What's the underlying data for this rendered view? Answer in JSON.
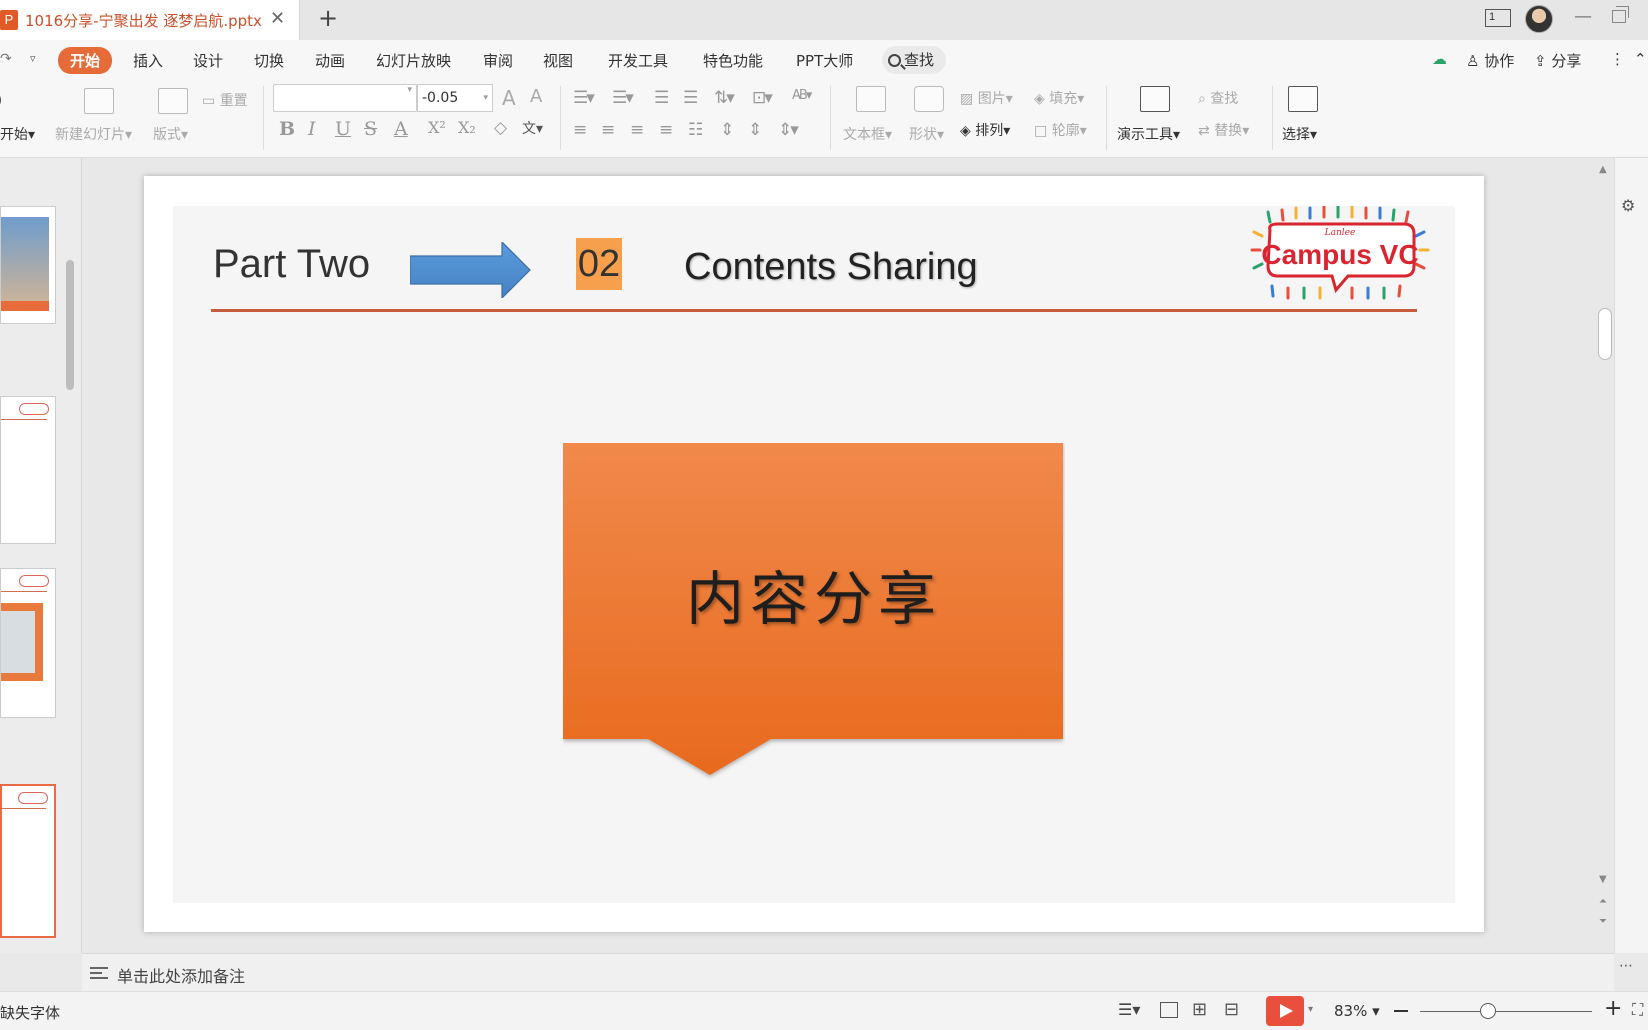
{
  "window": {
    "doc_tab_title": "1016分享-宁聚出发 逐梦启航.pptx",
    "doc_icon_glyph": "P",
    "page_indicator": "1"
  },
  "menu": {
    "items": [
      "开始",
      "插入",
      "设计",
      "切换",
      "动画",
      "幻灯片放映",
      "审阅",
      "视图",
      "开发工具",
      "特色功能",
      "PPT大师"
    ],
    "active": "开始",
    "search_label": "查找",
    "collab_label": "协作",
    "share_label": "分享"
  },
  "ribbon": {
    "start_label": "开始",
    "new_slide_label": "新建幻灯片",
    "layout_label": "版式",
    "reset_label": "重置",
    "font_size_value": "-0.05",
    "text_box_label": "文本框",
    "shape_label": "形状",
    "picture_label": "图片",
    "fill_label": "填充",
    "arrange_label": "排列",
    "outline_label": "轮廓",
    "presentation_tools_label": "演示工具",
    "find_label": "查找",
    "replace_label": "替换",
    "select_label": "选择"
  },
  "slide": {
    "part_label": "Part Two",
    "number": "02",
    "title": "Contents Sharing",
    "callout_text": "内容分享",
    "logo_text": "Campus VC",
    "logo_subtext": "Lanlee"
  },
  "notes": {
    "placeholder": "单击此处添加备注"
  },
  "status": {
    "missing_font": "缺失字体",
    "zoom": "83%"
  },
  "colors": {
    "accent": "#e56b39",
    "rule": "#c65c3c",
    "badge": "#f6a04d",
    "arrow": "#4f8fd1",
    "callout_top": "#f18847",
    "callout_bottom": "#e8651a"
  }
}
